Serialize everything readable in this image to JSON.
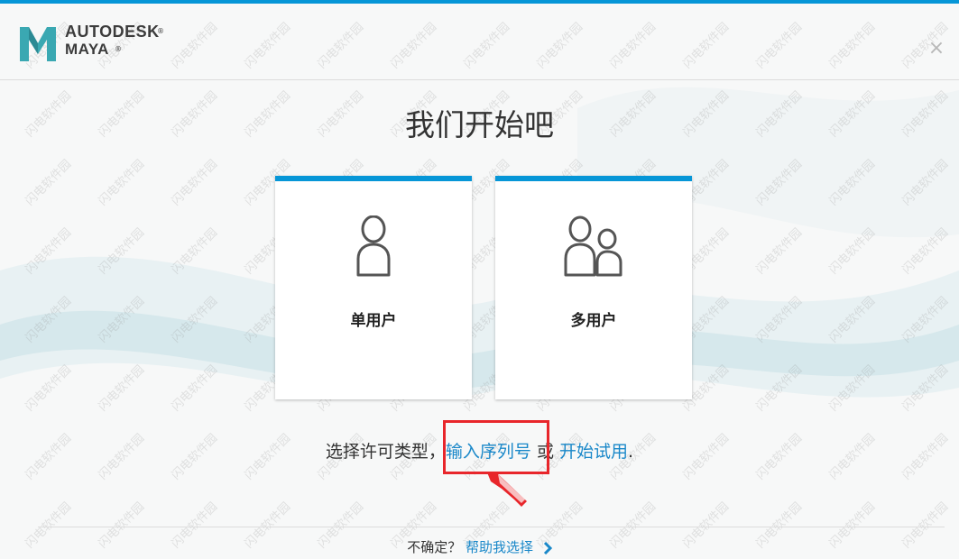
{
  "header": {
    "brand_line1": "AUTODESK",
    "brand_line2": "MAYA",
    "registered_mark": "®",
    "close_glyph": "×"
  },
  "title": "我们开始吧",
  "cards": [
    {
      "label": "单用户",
      "icon": "single-user-icon"
    },
    {
      "label": "多用户",
      "icon": "multi-user-icon"
    }
  ],
  "license": {
    "prefix": "选择许可类型，",
    "serial_link": "输入序列号",
    "or": " 或 ",
    "trial_link": "开始试用",
    "suffix": "."
  },
  "help": {
    "question": "不确定？",
    "link": "帮助我选择"
  },
  "watermark_text": "闪电软件园",
  "colors": {
    "accent": "#0696d7",
    "link": "#1a88c9",
    "highlight": "#e8262b",
    "logo_teal": "#3aa8b2"
  }
}
